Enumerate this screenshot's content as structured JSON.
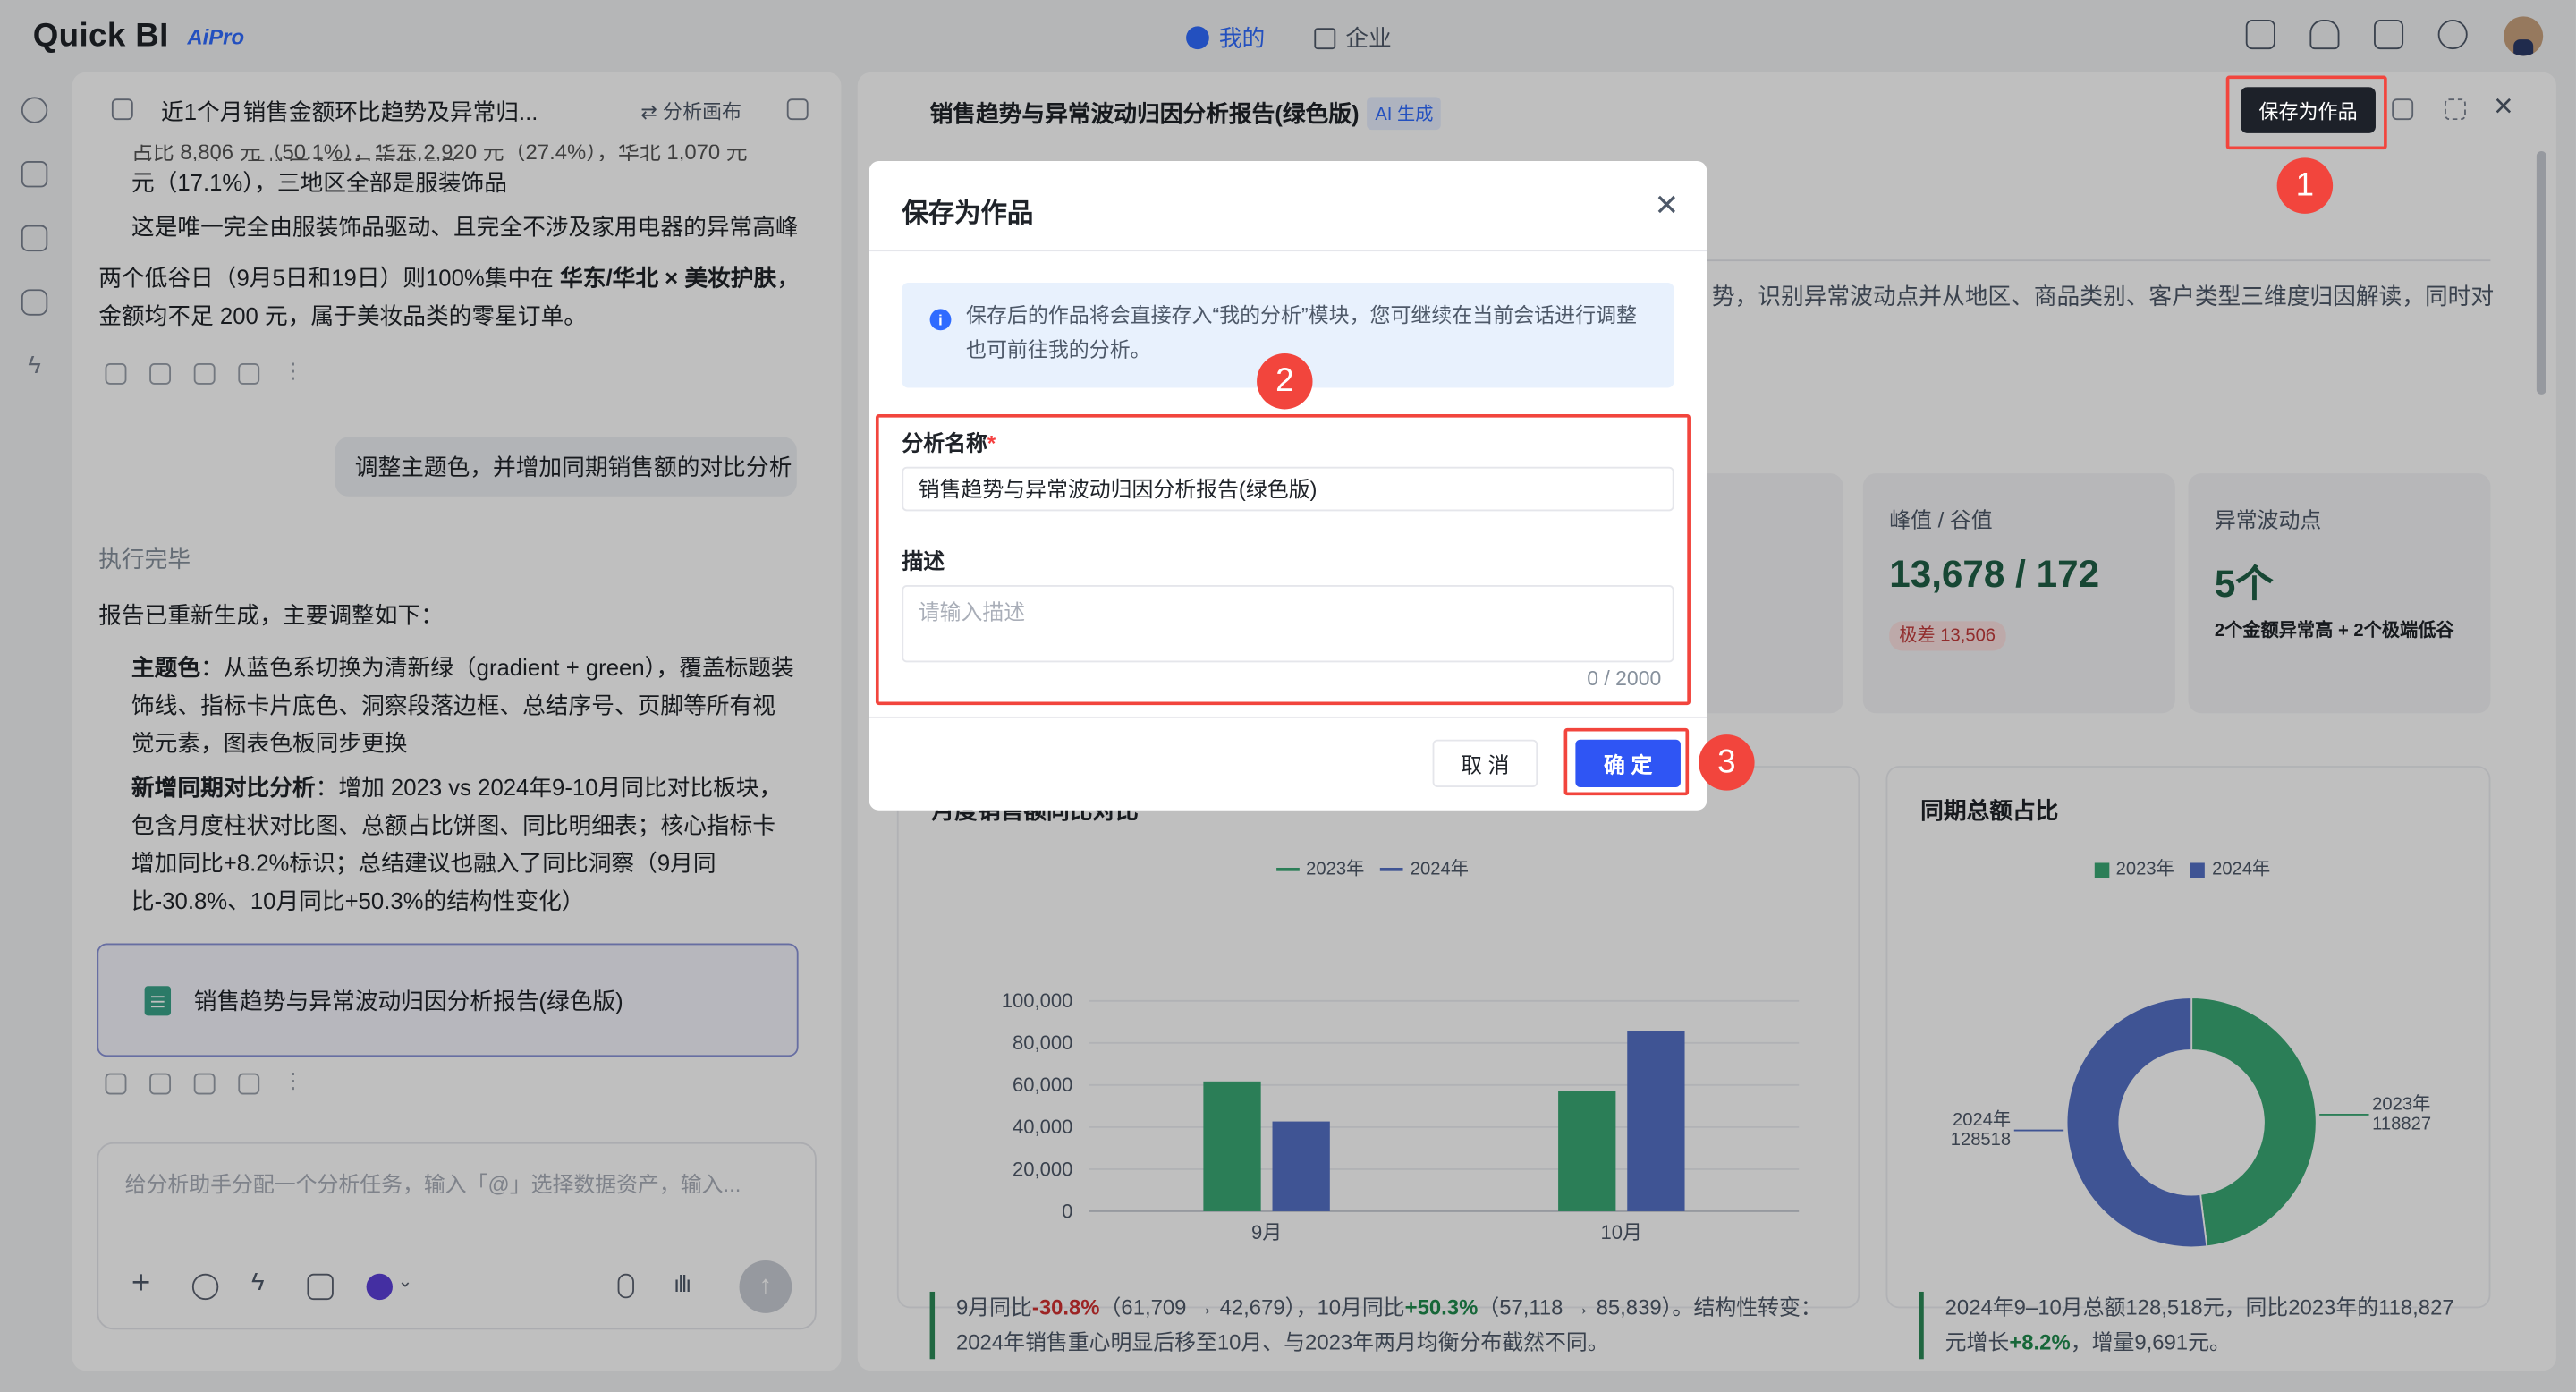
{
  "app": {
    "logo": "Quick BI",
    "ai_badge": "AiPro",
    "nav_mine": "我的",
    "nav_enterprise": "企业"
  },
  "left": {
    "title": "近1个月销售金额环比趋势及异常归...",
    "canvas_btn": "分析画布",
    "cut_line": "占比 8,806 元（50.1%），华东 2,920 元（27.4%），华北 1,070 元（17.1%），三地区全部是服装饰品",
    "line_a": "元（17.1%），三地区全部是服装饰品",
    "line_b": "这是唯一完全由服装饰品驱动、且完全不涉及家用电器的异常高峰",
    "line_c1": "两个低谷日（9月5日和19日）则100%集中在 ",
    "line_c_bold": "华东/华北 × 美妆护肤",
    "line_c2": "，金额均不足 200 元，属于美妆品类的零星订单。",
    "user_msg": "调整主题色，并增加同期销售额的对比分析",
    "status": "执行完毕",
    "summary": "报告已重新生成，主要调整如下：",
    "b1_title": "主题色",
    "b1_text": "：从蓝色系切换为清新绿（gradient + green），覆盖标题装饰线、指标卡片底色、洞察段落边框、总结序号、页脚等所有视觉元素，图表色板同步更换",
    "b2_title": "新增同期对比分析",
    "b2_text": "：增加 2023 vs 2024年9-10月同比对比板块，包含月度柱状对比图、总额占比饼图、同比明细表；核心指标卡增加同比+8.2%标识；总结建议也融入了同比洞察（9月同比-30.8%、10月同比+50.3%的结构性变化）",
    "file_card": "销售趋势与异常波动归因分析报告(绿色版)",
    "input_placeholder": "给分析助手分配一个分析任务，输入「@」选择数据资产，输入..."
  },
  "right": {
    "title": "销售趋势与异常波动归因分析报告(绿色版)",
    "ai_tag": "AI 生成",
    "save_btn": "保存为作品",
    "intro": "势，识别异常波动点并从地区、商品类别、客户类型三维度归因解读，同时对",
    "kpi1": {
      "label": "峰值 / 谷值",
      "value": "13,678 / 172",
      "sub": "极差 13,506"
    },
    "kpi2": {
      "label": "异常波动点",
      "value": "5个",
      "sub": "2个金额异常高 + 2个极端低谷"
    },
    "chart1_title": "月度销售额同比对比",
    "chart2_title": "同期总额占比",
    "note1": {
      "p1": "9月同比",
      "v1": "-30.8%",
      "p2": "（61,709 → 42,679），10月同比",
      "v2": "+50.3%",
      "p3": "（57,118 → 85,839）。结构性转变：2024年销售重心明显后移至10月、与2023年两月均衡分布截然不同。"
    },
    "note2": {
      "p1": "2024年9–10月总额128,518元，同比2023年的118,827元增长",
      "v1": "+8.2%",
      "p2": "，增量9,691元。"
    }
  },
  "modal": {
    "title": "保存为作品",
    "info": "保存后的作品将会直接存入“我的分析”模块，您可继续在当前会话进行调整也可前往我的分析。",
    "name_label": "分析名称",
    "name_value": "销售趋势与异常波动归因分析报告(绿色版)",
    "desc_label": "描述",
    "desc_placeholder": "请输入描述",
    "counter": "0 / 2000",
    "cancel": "取 消",
    "ok": "确 定"
  },
  "steps": [
    "1",
    "2",
    "3"
  ],
  "colors": {
    "accent": "#2f6bff",
    "green": "#3aa874",
    "blue": "#5470c6",
    "annot": "#f2453d"
  },
  "chart_data": [
    {
      "type": "bar",
      "title": "月度销售额同比对比",
      "categories": [
        "9月",
        "10月"
      ],
      "series": [
        {
          "name": "2023年",
          "values": [
            61709,
            57118
          ]
        },
        {
          "name": "2024年",
          "values": [
            42679,
            85839
          ]
        }
      ],
      "ylim": [
        0,
        100000
      ],
      "yticks": [
        "100,000",
        "80,000",
        "60,000",
        "40,000",
        "20,000",
        "0"
      ],
      "legend": "top-center",
      "grid": true
    },
    {
      "type": "pie",
      "title": "同期总额占比",
      "series": [
        {
          "name": "2023年",
          "value": 118827
        },
        {
          "name": "2024年",
          "value": 128518
        }
      ],
      "labels": [
        "2023年 118827",
        "2024年 128518"
      ],
      "legend": "top-center"
    }
  ]
}
